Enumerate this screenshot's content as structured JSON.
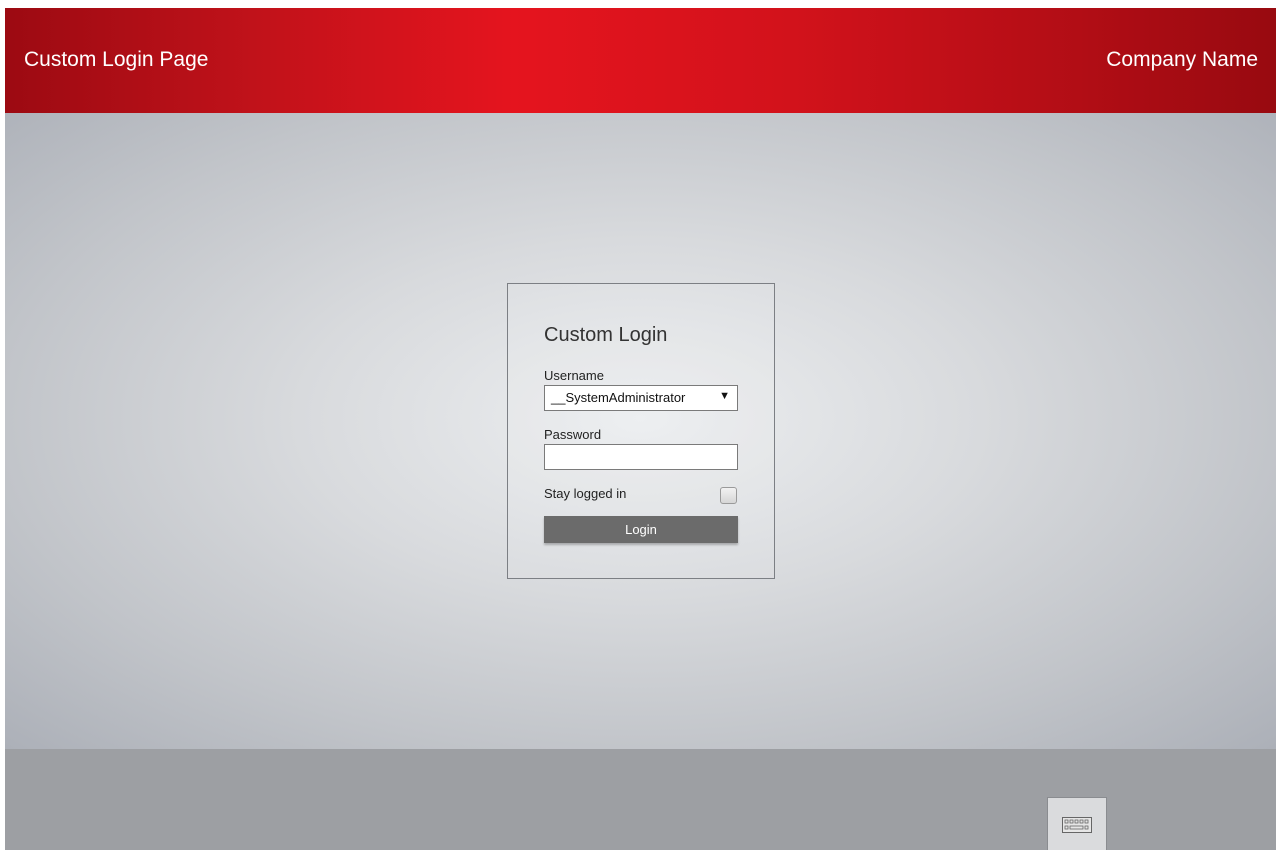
{
  "header": {
    "title": "Custom Login Page",
    "company": "Company Name",
    "accent_color": "#e5141e"
  },
  "login": {
    "heading": "Custom Login",
    "username_label": "Username",
    "username_value": "__SystemAdministrator",
    "password_label": "Password",
    "password_value": "",
    "stay_logged_in_label": "Stay logged in",
    "stay_logged_in_checked": false,
    "login_button_label": "Login",
    "button_color": "#6b6b6b"
  },
  "footer": {
    "keyboard_icon": "keyboard-icon"
  }
}
